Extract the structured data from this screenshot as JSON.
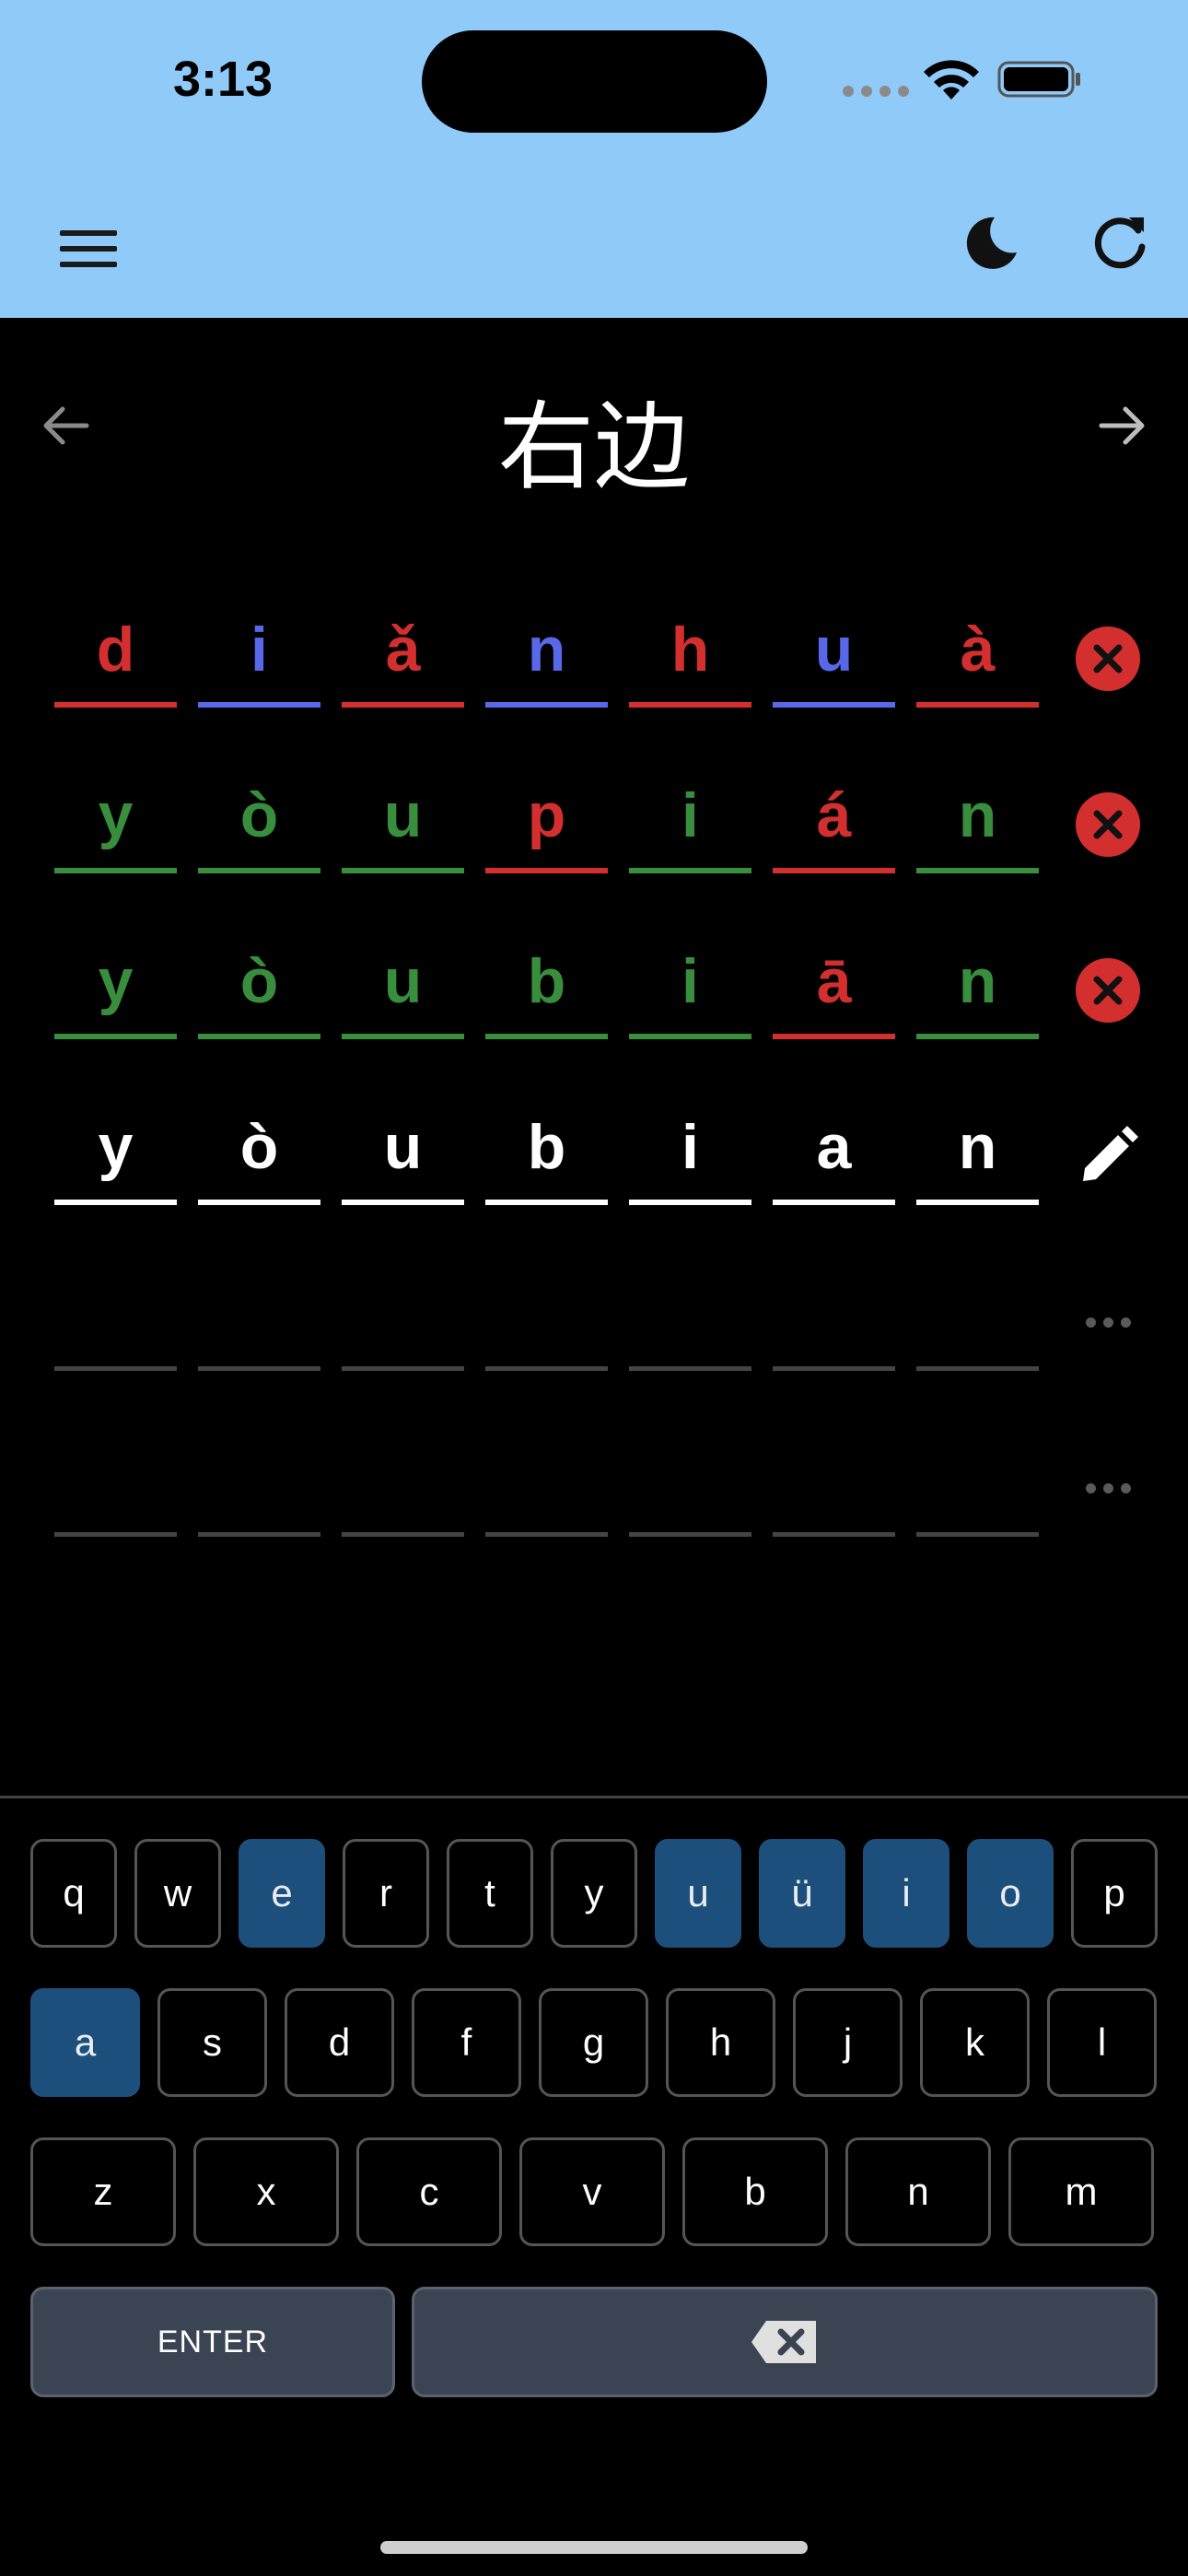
{
  "status_bar": {
    "time": "3:13"
  },
  "word": {
    "title": "右边"
  },
  "rows": [
    {
      "cells": [
        {
          "ch": "d",
          "color": "red"
        },
        {
          "ch": "i",
          "color": "blue"
        },
        {
          "ch": "ǎ",
          "color": "red"
        },
        {
          "ch": "n",
          "color": "blue"
        },
        {
          "ch": "h",
          "color": "red"
        },
        {
          "ch": "u",
          "color": "blue"
        },
        {
          "ch": "à",
          "color": "red"
        }
      ],
      "status": "incorrect"
    },
    {
      "cells": [
        {
          "ch": "y",
          "color": "green"
        },
        {
          "ch": "ò",
          "color": "green"
        },
        {
          "ch": "u",
          "color": "green"
        },
        {
          "ch": "p",
          "color": "red"
        },
        {
          "ch": "i",
          "color": "green"
        },
        {
          "ch": "á",
          "color": "red"
        },
        {
          "ch": "n",
          "color": "green"
        }
      ],
      "status": "incorrect"
    },
    {
      "cells": [
        {
          "ch": "y",
          "color": "green"
        },
        {
          "ch": "ò",
          "color": "green"
        },
        {
          "ch": "u",
          "color": "green"
        },
        {
          "ch": "b",
          "color": "green"
        },
        {
          "ch": "i",
          "color": "green"
        },
        {
          "ch": "ā",
          "color": "red"
        },
        {
          "ch": "n",
          "color": "green"
        }
      ],
      "status": "incorrect"
    },
    {
      "cells": [
        {
          "ch": "y",
          "color": "white"
        },
        {
          "ch": "ò",
          "color": "white"
        },
        {
          "ch": "u",
          "color": "white"
        },
        {
          "ch": "b",
          "color": "white"
        },
        {
          "ch": "i",
          "color": "white"
        },
        {
          "ch": "a",
          "color": "white"
        },
        {
          "ch": "n",
          "color": "white"
        }
      ],
      "status": "editing"
    },
    {
      "cells": [
        {
          "ch": "",
          "color": "empty"
        },
        {
          "ch": "",
          "color": "empty"
        },
        {
          "ch": "",
          "color": "empty"
        },
        {
          "ch": "",
          "color": "empty"
        },
        {
          "ch": "",
          "color": "empty"
        },
        {
          "ch": "",
          "color": "empty"
        },
        {
          "ch": "",
          "color": "empty"
        }
      ],
      "status": "pending"
    },
    {
      "cells": [
        {
          "ch": "",
          "color": "empty"
        },
        {
          "ch": "",
          "color": "empty"
        },
        {
          "ch": "",
          "color": "empty"
        },
        {
          "ch": "",
          "color": "empty"
        },
        {
          "ch": "",
          "color": "empty"
        },
        {
          "ch": "",
          "color": "empty"
        },
        {
          "ch": "",
          "color": "empty"
        }
      ],
      "status": "pending"
    }
  ],
  "keyboard": {
    "row1": [
      {
        "label": "q",
        "hl": false
      },
      {
        "label": "w",
        "hl": false
      },
      {
        "label": "e",
        "hl": true
      },
      {
        "label": "r",
        "hl": false
      },
      {
        "label": "t",
        "hl": false
      },
      {
        "label": "y",
        "hl": false
      },
      {
        "label": "u",
        "hl": true
      },
      {
        "label": "ü",
        "hl": true
      },
      {
        "label": "i",
        "hl": true
      },
      {
        "label": "o",
        "hl": true
      },
      {
        "label": "p",
        "hl": false
      }
    ],
    "row2": [
      {
        "label": "a",
        "hl": true
      },
      {
        "label": "s",
        "hl": false
      },
      {
        "label": "d",
        "hl": false
      },
      {
        "label": "f",
        "hl": false
      },
      {
        "label": "g",
        "hl": false
      },
      {
        "label": "h",
        "hl": false
      },
      {
        "label": "j",
        "hl": false
      },
      {
        "label": "k",
        "hl": false
      },
      {
        "label": "l",
        "hl": false
      }
    ],
    "row3": [
      {
        "label": "z",
        "hl": false
      },
      {
        "label": "x",
        "hl": false
      },
      {
        "label": "c",
        "hl": false
      },
      {
        "label": "v",
        "hl": false
      },
      {
        "label": "b",
        "hl": false
      },
      {
        "label": "n",
        "hl": false
      },
      {
        "label": "m",
        "hl": false
      }
    ],
    "enter_label": "ENTER"
  },
  "colors": {
    "header_bg": "#90caf9",
    "red": "#d32f2f",
    "blue": "#5868e8",
    "green": "#388e3c",
    "key_highlight": "#1d4f7c",
    "action_key": "#3b4452"
  },
  "icons": [
    "menu-icon",
    "moon-icon",
    "refresh-icon",
    "arrow-left-icon",
    "arrow-right-icon",
    "close-circle-icon",
    "pencil-icon",
    "more-dots-icon",
    "backspace-icon",
    "wifi-icon",
    "battery-icon"
  ]
}
